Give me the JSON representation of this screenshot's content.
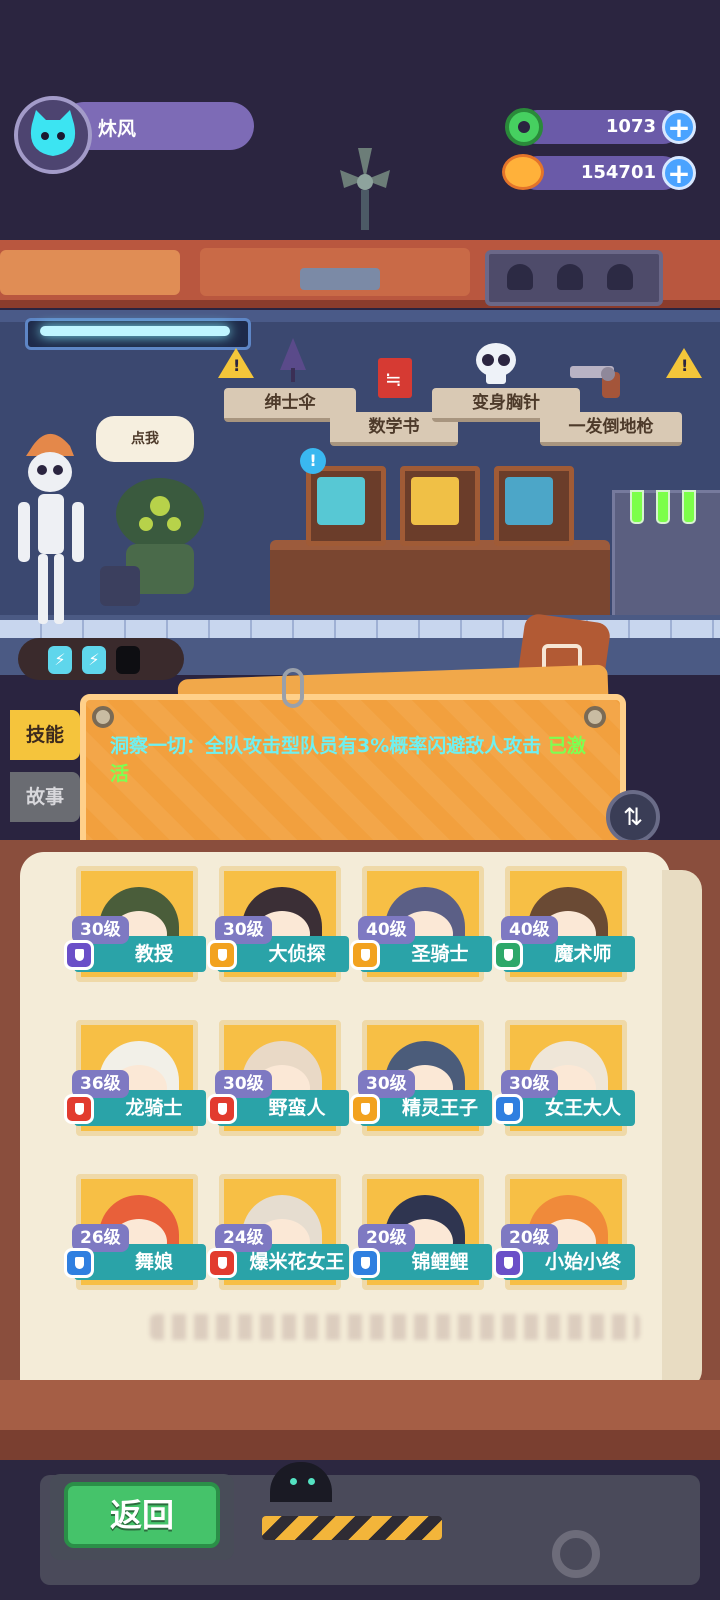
{
  "player": {
    "name": "炑风"
  },
  "currencies": [
    {
      "icon": "donut-gem-icon",
      "value": "1073"
    },
    {
      "icon": "planet-coin-icon",
      "value": "154701"
    }
  ],
  "scene": {
    "items": [
      {
        "label": "绅士伞",
        "icon": "umbrella-icon"
      },
      {
        "label": "数学书",
        "icon": "book-icon"
      },
      {
        "label": "变身胸针",
        "icon": "skull-icon"
      },
      {
        "label": "一发倒地枪",
        "icon": "revolver-icon"
      }
    ],
    "bubble": "点我",
    "energy": [
      "⚡",
      "⚡",
      ""
    ]
  },
  "tabs": {
    "skill": "技能",
    "story": "故事"
  },
  "skill": {
    "text": "洞察一切：全队攻击型队员有3%概率闪避敌人攻击",
    "status": "已激活"
  },
  "characters": [
    {
      "level": "30级",
      "name": "教授",
      "badge": "#6a4fc8",
      "portrait": "#4a5d3a"
    },
    {
      "level": "30级",
      "name": "大侦探",
      "badge": "#f2a21f",
      "portrait": "#3b2f36"
    },
    {
      "level": "40级",
      "name": "圣骑士",
      "badge": "#f2a21f",
      "portrait": "#5b5f86"
    },
    {
      "level": "40级",
      "name": "魔术师",
      "badge": "#2ea86a",
      "portrait": "#6a4a34"
    },
    {
      "level": "36级",
      "name": "龙骑士",
      "badge": "#e23b2e",
      "portrait": "#f2f0e8"
    },
    {
      "level": "30级",
      "name": "野蛮人",
      "badge": "#e23b2e",
      "portrait": "#e9d9c6"
    },
    {
      "level": "30级",
      "name": "精灵王子",
      "badge": "#f2a21f",
      "portrait": "#4b5c7a"
    },
    {
      "level": "30级",
      "name": "女王大人",
      "badge": "#2f7fe0",
      "portrait": "#efe6d8"
    },
    {
      "level": "26级",
      "name": "舞娘",
      "badge": "#2f7fe0",
      "portrait": "#e8603a"
    },
    {
      "level": "24级",
      "name": "爆米花女王",
      "badge": "#e23b2e",
      "portrait": "#e6ddd0"
    },
    {
      "level": "20级",
      "name": "锦鲤鲤",
      "badge": "#2f7fe0",
      "portrait": "#2f3550"
    },
    {
      "level": "20级",
      "name": "小始小终",
      "badge": "#6a4fc8",
      "portrait": "#f08a3a"
    }
  ],
  "bottom": {
    "back_label": "返回"
  }
}
